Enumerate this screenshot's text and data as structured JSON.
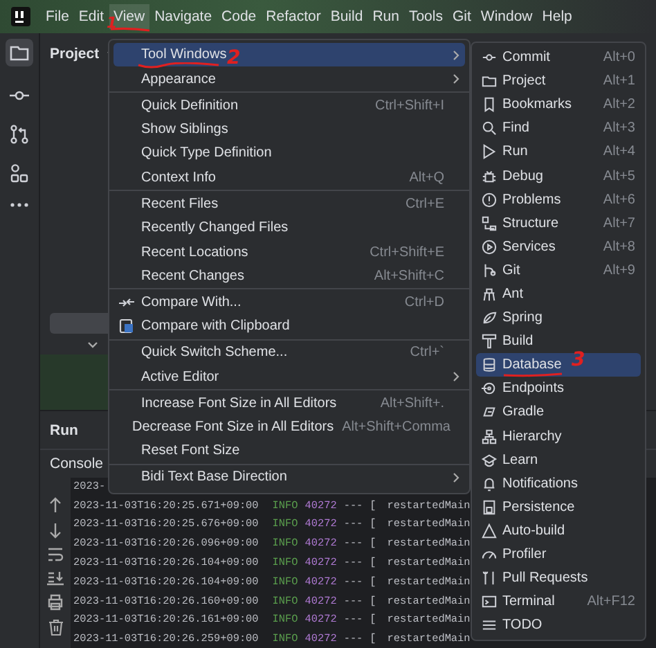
{
  "menubar": [
    {
      "label": "File",
      "selected": false
    },
    {
      "label": "Edit",
      "selected": false
    },
    {
      "label": "View",
      "selected": true,
      "annotation": "1"
    },
    {
      "label": "Navigate",
      "selected": false
    },
    {
      "label": "Code",
      "selected": false
    },
    {
      "label": "Refactor",
      "selected": false
    },
    {
      "label": "Build",
      "selected": false
    },
    {
      "label": "Run",
      "selected": false
    },
    {
      "label": "Tools",
      "selected": false
    },
    {
      "label": "Git",
      "selected": false
    },
    {
      "label": "Window",
      "selected": false
    },
    {
      "label": "Help",
      "selected": false
    }
  ],
  "project_panel": {
    "title": "Project"
  },
  "run_panel": {
    "title": "Run",
    "tab": "Console"
  },
  "console_rows": [
    {
      "timestamp": "2023-"
    },
    {
      "timestamp": "2023-11-03T16:20:25.671+09:00",
      "level": "INFO",
      "pid": "40272",
      "sep": "---",
      "bracket": "[",
      "thread": "restartedMain"
    },
    {
      "timestamp": "2023-11-03T16:20:25.676+09:00",
      "level": "INFO",
      "pid": "40272",
      "sep": "---",
      "bracket": "[",
      "thread": "restartedMain"
    },
    {
      "timestamp": "2023-11-03T16:20:26.096+09:00",
      "level": "INFO",
      "pid": "40272",
      "sep": "---",
      "bracket": "[",
      "thread": "restartedMain"
    },
    {
      "timestamp": "2023-11-03T16:20:26.104+09:00",
      "level": "INFO",
      "pid": "40272",
      "sep": "---",
      "bracket": "[",
      "thread": "restartedMain"
    },
    {
      "timestamp": "2023-11-03T16:20:26.104+09:00",
      "level": "INFO",
      "pid": "40272",
      "sep": "---",
      "bracket": "[",
      "thread": "restartedMain"
    },
    {
      "timestamp": "2023-11-03T16:20:26.160+09:00",
      "level": "INFO",
      "pid": "40272",
      "sep": "---",
      "bracket": "[",
      "thread": "restartedMain"
    },
    {
      "timestamp": "2023-11-03T16:20:26.161+09:00",
      "level": "INFO",
      "pid": "40272",
      "sep": "---",
      "bracket": "[",
      "thread": "restartedMain"
    },
    {
      "timestamp": "2023-11-03T16:20:26.259+09:00",
      "level": "INFO",
      "pid": "40272",
      "sep": "---",
      "bracket": "[",
      "thread": "restartedMain"
    }
  ],
  "view_menu": [
    [
      {
        "label": "Tool Windows",
        "has_submenu": true,
        "selected": true,
        "annotation": "2"
      },
      {
        "label": "Appearance",
        "has_submenu": true,
        "selected": false
      }
    ],
    [
      {
        "label": "Quick Definition",
        "shortcut": "Ctrl+Shift+I",
        "has_submenu": false,
        "selected": false
      },
      {
        "label": "Show Siblings",
        "has_submenu": false,
        "selected": false
      },
      {
        "label": "Quick Type Definition",
        "has_submenu": false,
        "selected": false
      },
      {
        "label": "Context Info",
        "shortcut": "Alt+Q",
        "has_submenu": false,
        "selected": false
      }
    ],
    [
      {
        "label": "Recent Files",
        "shortcut": "Ctrl+E",
        "has_submenu": false,
        "selected": false
      },
      {
        "label": "Recently Changed Files",
        "has_submenu": false,
        "selected": false
      },
      {
        "label": "Recent Locations",
        "shortcut": "Ctrl+Shift+E",
        "has_submenu": false,
        "selected": false
      },
      {
        "label": "Recent Changes",
        "shortcut": "Alt+Shift+C",
        "has_submenu": false,
        "selected": false
      }
    ],
    [
      {
        "label": "Compare With...",
        "shortcut": "Ctrl+D",
        "has_submenu": false,
        "selected": false
      },
      {
        "label": "Compare with Clipboard",
        "has_submenu": false,
        "selected": false
      }
    ],
    [
      {
        "label": "Quick Switch Scheme...",
        "shortcut": "Ctrl+`",
        "has_submenu": false,
        "selected": false
      },
      {
        "label": "Active Editor",
        "has_submenu": true,
        "selected": false
      }
    ],
    [
      {
        "label": "Increase Font Size in All Editors",
        "shortcut": "Alt+Shift+.",
        "has_submenu": false,
        "selected": false
      },
      {
        "label": "Decrease Font Size in All Editors",
        "shortcut": "Alt+Shift+Comma",
        "has_submenu": false,
        "selected": false
      },
      {
        "label": "Reset Font Size",
        "has_submenu": false,
        "selected": false
      }
    ],
    [
      {
        "label": "Bidi Text Base Direction",
        "has_submenu": true,
        "selected": false
      }
    ]
  ],
  "tool_windows_menu": [
    {
      "label": "Commit",
      "shortcut": "Alt+0",
      "selected": false
    },
    {
      "label": "Project",
      "shortcut": "Alt+1",
      "selected": false
    },
    {
      "label": "Bookmarks",
      "shortcut": "Alt+2",
      "selected": false
    },
    {
      "label": "Find",
      "shortcut": "Alt+3",
      "selected": false
    },
    {
      "label": "Run",
      "shortcut": "Alt+4",
      "selected": false
    },
    {
      "label": "Debug",
      "shortcut": "Alt+5",
      "selected": false
    },
    {
      "label": "Problems",
      "shortcut": "Alt+6",
      "selected": false
    },
    {
      "label": "Structure",
      "shortcut": "Alt+7",
      "selected": false
    },
    {
      "label": "Services",
      "shortcut": "Alt+8",
      "selected": false
    },
    {
      "label": "Git",
      "shortcut": "Alt+9",
      "selected": false
    },
    {
      "label": "Ant",
      "selected": false
    },
    {
      "label": "Spring",
      "selected": false
    },
    {
      "label": "Build",
      "selected": false
    },
    {
      "label": "Database",
      "selected": true,
      "annotation": "3"
    },
    {
      "label": "Endpoints",
      "selected": false
    },
    {
      "label": "Gradle",
      "selected": false
    },
    {
      "label": "Hierarchy",
      "selected": false
    },
    {
      "label": "Learn",
      "selected": false
    },
    {
      "label": "Notifications",
      "selected": false
    },
    {
      "label": "Persistence",
      "selected": false
    },
    {
      "label": "Auto-build",
      "selected": false
    },
    {
      "label": "Profiler",
      "selected": false
    },
    {
      "label": "Pull Requests",
      "selected": false
    },
    {
      "label": "Terminal",
      "shortcut": "Alt+F12",
      "selected": false
    },
    {
      "label": "TODO",
      "selected": false
    }
  ]
}
